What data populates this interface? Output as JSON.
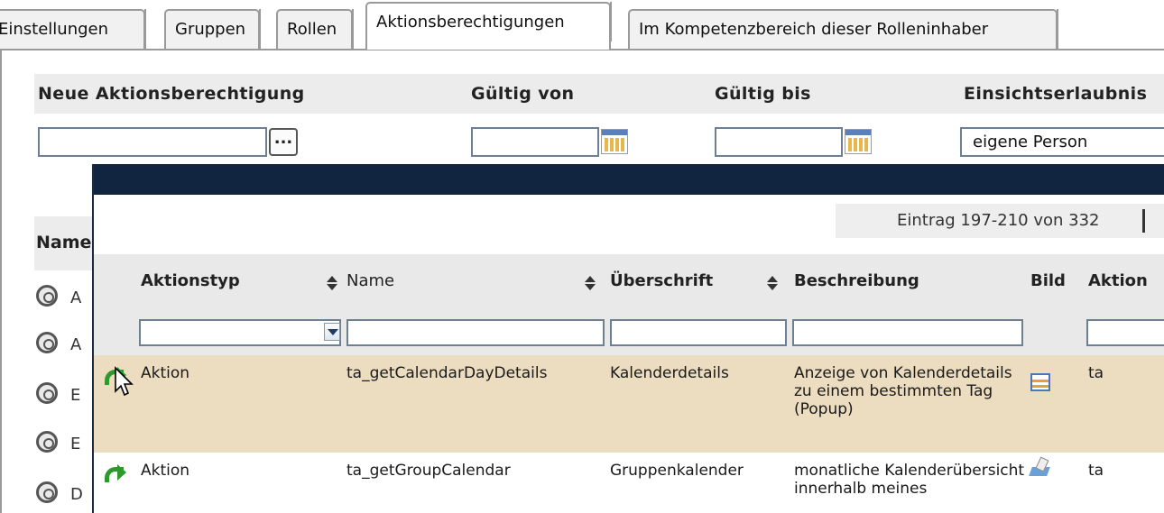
{
  "tabs": [
    "Einstellungen",
    "Gruppen",
    "Rollen",
    "Aktionsberechtigungen",
    "Im Kompetenzbereich dieser Rolleninhaber"
  ],
  "active_tab": "Aktionsberechtigungen",
  "form": {
    "headers": {
      "new": "Neue Aktionsberechtigung",
      "valid_from": "Gültig von",
      "valid_to": "Gültig bis",
      "visibility": "Einsichtserlaubnis"
    },
    "browse_label": "...",
    "visibility_value": "eigene Person"
  },
  "background_list": {
    "header": "Name",
    "row_letters": [
      "A",
      "A",
      "E",
      "E",
      "D"
    ]
  },
  "popup": {
    "pager": "Eintrag 197-210 von 332",
    "columns": [
      "Aktionstyp",
      "Name",
      "Überschrift",
      "Beschreibung",
      "Bild",
      "Aktion"
    ],
    "rows": [
      {
        "icon": "green-arrow-icon",
        "aktionstyp": "Aktion",
        "name": "ta_getCalendarDayDetails",
        "ueberschrift": "Kalenderdetails",
        "beschreibung": "Anzeige von Kalenderdetails zu einem bestimmten Tag (Popup)",
        "bild": "calendar-icon",
        "aktion": "ta",
        "highlighted": true
      },
      {
        "icon": "green-arrow-icon",
        "aktionstyp": "Aktion",
        "name": "ta_getGroupCalendar",
        "ueberschrift": "Gruppenkalender",
        "beschreibung": "monatliche Kalenderübersicht innerhalb meines",
        "bild": "group-calendar-icon",
        "aktion": "ta",
        "highlighted": false
      }
    ]
  },
  "colors": {
    "popup_titlebar": "#122540",
    "row_highlight": "#ecdcc0",
    "header_bg": "#e9e9e9",
    "select_arrow": "#1f3c66"
  }
}
